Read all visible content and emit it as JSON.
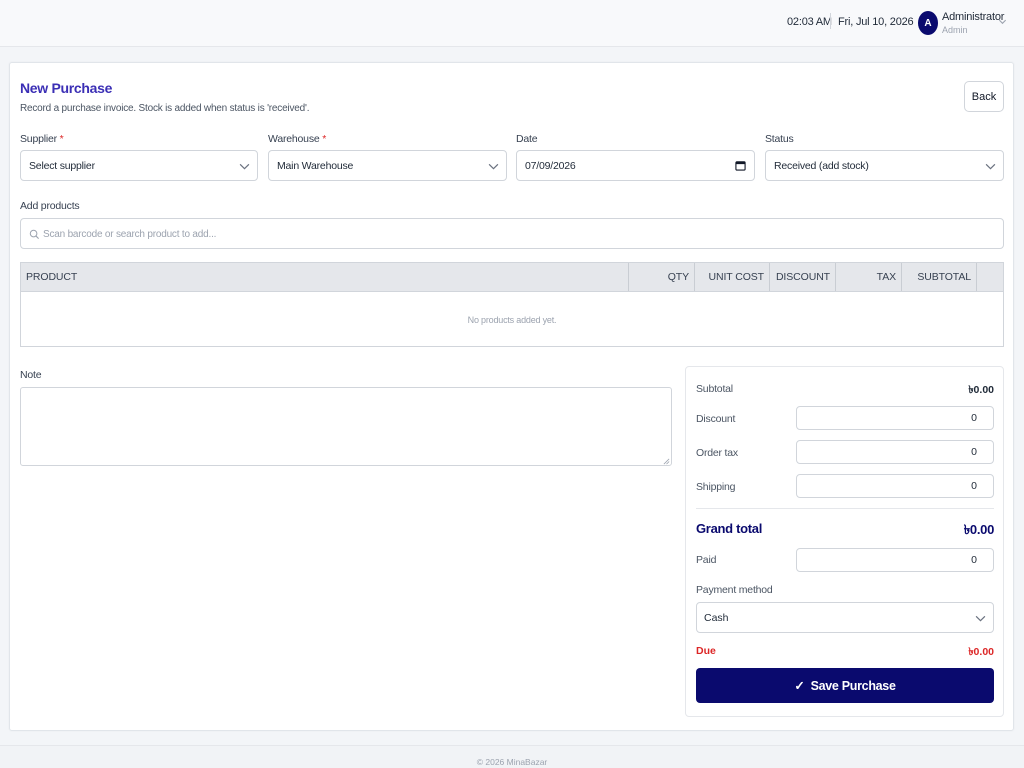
{
  "topbar": {
    "time": "02:03 AM",
    "date": "Fri, Jul 10, 2026",
    "user": {
      "initial": "A",
      "name": "Administrator",
      "role": "Admin"
    }
  },
  "page": {
    "title": "New Purchase",
    "subtitle": "Record a purchase invoice. Stock is added when status is 'received'.",
    "back_label": "Back"
  },
  "form": {
    "supplier": {
      "label": "Supplier",
      "required_mark": "*",
      "value": "Select supplier"
    },
    "warehouse": {
      "label": "Warehouse",
      "required_mark": "*",
      "value": "Main Warehouse"
    },
    "date": {
      "label": "Date",
      "value": "07/09/2026"
    },
    "status": {
      "label": "Status",
      "value": "Received (add stock)"
    },
    "add_products": {
      "label": "Add products",
      "placeholder": "Scan barcode or search product to add..."
    }
  },
  "table": {
    "columns": [
      "PRODUCT",
      "QTY",
      "UNIT COST",
      "DISCOUNT",
      "TAX",
      "SUBTOTAL"
    ],
    "empty_message": "No products added yet."
  },
  "note": {
    "label": "Note",
    "value": ""
  },
  "summary": {
    "subtotal_label": "Subtotal",
    "subtotal_value": "৳0.00",
    "discount_label": "Discount",
    "discount_value": "0",
    "order_tax_label": "Order tax",
    "order_tax_value": "0",
    "shipping_label": "Shipping",
    "shipping_value": "0",
    "grand_total_label": "Grand total",
    "grand_total_value": "৳0.00",
    "paid_label": "Paid",
    "paid_value": "0",
    "payment_method_label": "Payment method",
    "payment_method_value": "Cash",
    "due_label": "Due",
    "due_value": "৳0.00",
    "save_label": "Save Purchase",
    "save_icon": "✓"
  },
  "footer": {
    "text": "© 2026 MinaBazar"
  },
  "colors": {
    "primary": "#0a0a6e",
    "title": "#3b2fb5",
    "danger": "#dc2626"
  }
}
